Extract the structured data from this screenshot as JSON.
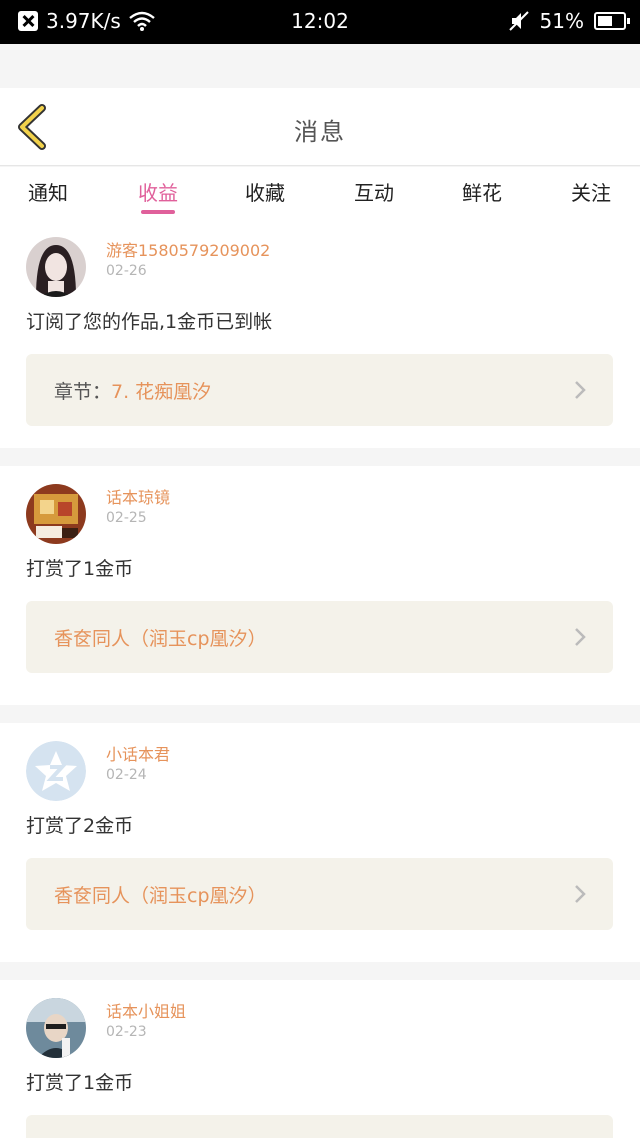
{
  "status_bar": {
    "speed": "3.97K/s",
    "time": "12:02",
    "battery": "51%"
  },
  "header": {
    "title": "消息"
  },
  "tabs": [
    {
      "label": "通知"
    },
    {
      "label": "收益"
    },
    {
      "label": "收藏"
    },
    {
      "label": "互动"
    },
    {
      "label": "鲜花"
    },
    {
      "label": "关注"
    }
  ],
  "active_tab": "收益",
  "items": [
    {
      "username": "游客1580579209002",
      "date": "02-26",
      "message": "订阅了您的作品,1金币已到帐",
      "link_prefix": "章节：",
      "link": "7. 花痴凰汐"
    },
    {
      "username": "话本琼镜",
      "date": "02-25",
      "message": "打赏了1金币",
      "link": "香奁同人（润玉cp凰汐）"
    },
    {
      "username": "小话本君",
      "date": "02-24",
      "message": "打赏了2金币",
      "link": "香奁同人（润玉cp凰汐）"
    },
    {
      "username": "话本小姐姐",
      "date": "02-23",
      "message": "打赏了1金币"
    }
  ],
  "colors": {
    "accent": "#e0609b",
    "name": "#e6935b",
    "back_arrow": "#f2d24b"
  }
}
